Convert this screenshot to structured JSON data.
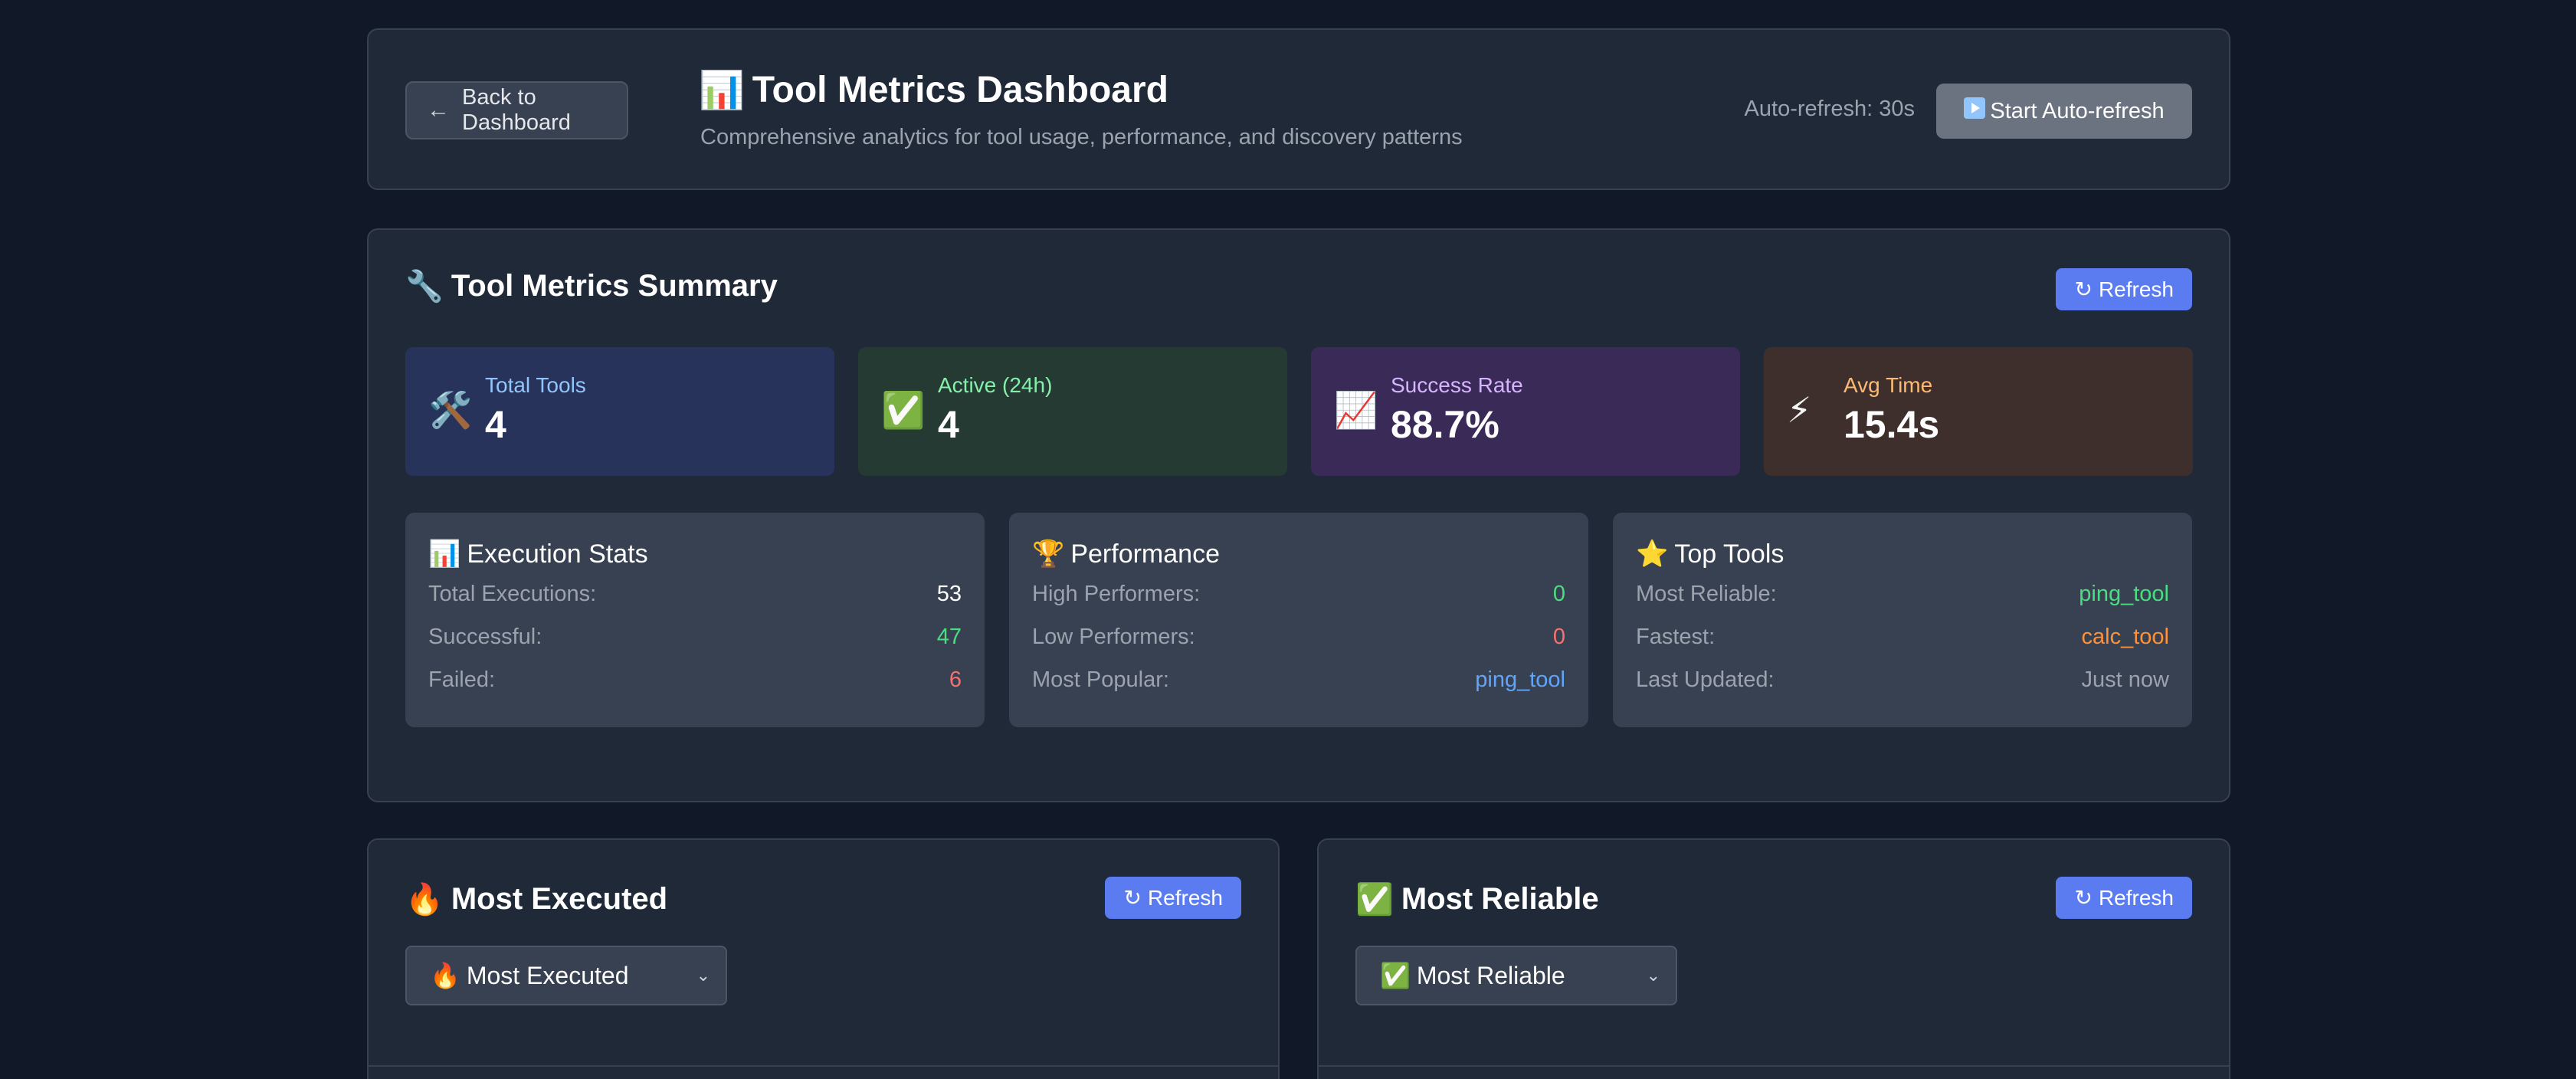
{
  "header": {
    "back_label": "Back to Dashboard",
    "title": "Tool Metrics Dashboard",
    "subtitle": "Comprehensive analytics for tool usage, performance, and discovery patterns",
    "auto_refresh_label": "Auto-refresh: 30s",
    "auto_refresh_button": "Start Auto-refresh"
  },
  "summary": {
    "title": "Tool Metrics Summary",
    "refresh_label": "Refresh",
    "stats": [
      {
        "label": "Total Tools",
        "value": "4",
        "icon": "tools-icon",
        "label_color": "#93c5fd",
        "bg": "#27335a"
      },
      {
        "label": "Active (24h)",
        "value": "4",
        "icon": "check-icon",
        "label_color": "#86efac",
        "bg": "#243a33"
      },
      {
        "label": "Success Rate",
        "value": "88.7%",
        "icon": "chart-up-icon",
        "label_color": "#d8b4fe",
        "bg": "#3a2a58"
      },
      {
        "label": "Avg Time",
        "value": "15.4s",
        "icon": "lightning-icon",
        "label_color": "#fdba74",
        "bg": "#3e2e2c"
      }
    ],
    "execution_stats": {
      "title": "Execution Stats",
      "rows": [
        {
          "key": "Total Executions:",
          "value": "53",
          "color": "#ffffff"
        },
        {
          "key": "Successful:",
          "value": "47",
          "color": "#4ade80"
        },
        {
          "key": "Failed:",
          "value": "6",
          "color": "#f87171"
        }
      ]
    },
    "performance": {
      "title": "Performance",
      "rows": [
        {
          "key": "High Performers:",
          "value": "0",
          "color": "#4ade80"
        },
        {
          "key": "Low Performers:",
          "value": "0",
          "color": "#f87171"
        },
        {
          "key": "Most Popular:",
          "value": "ping_tool",
          "color": "#60a5fa"
        }
      ]
    },
    "top_tools": {
      "title": "Top Tools",
      "rows": [
        {
          "key": "Most Reliable:",
          "value": "ping_tool",
          "color": "#4ade80"
        },
        {
          "key": "Fastest:",
          "value": "calc_tool",
          "color": "#fb923c"
        },
        {
          "key": "Last Updated:",
          "value": "Just now",
          "color": "#9ca3af"
        }
      ]
    }
  },
  "most_executed": {
    "title": "Most Executed",
    "refresh_label": "Refresh",
    "select_value": "Most Executed"
  },
  "most_reliable": {
    "title": "Most Reliable",
    "refresh_label": "Refresh",
    "select_value": "Most Reliable"
  }
}
